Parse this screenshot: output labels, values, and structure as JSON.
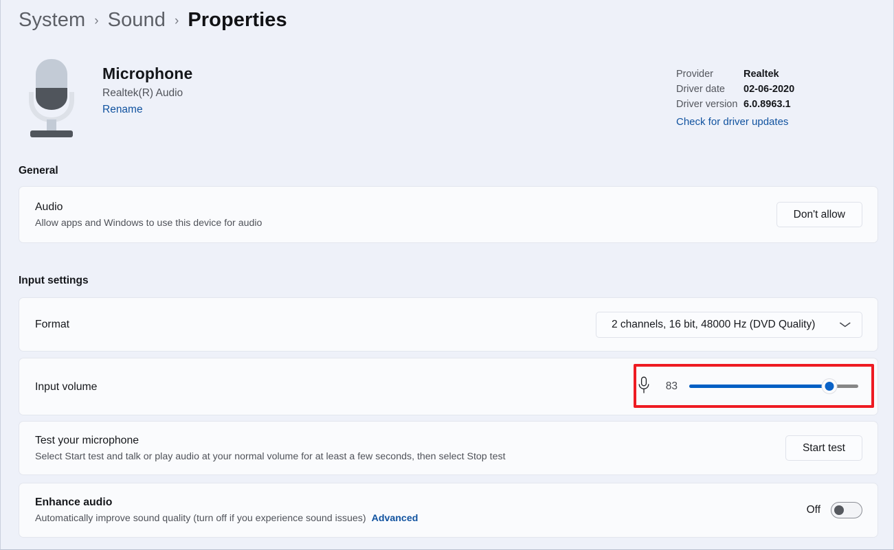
{
  "breadcrumb": {
    "items": [
      {
        "label": "System",
        "current": false
      },
      {
        "label": "Sound",
        "current": false
      },
      {
        "label": "Properties",
        "current": true
      }
    ],
    "separator": "›"
  },
  "device": {
    "icon": "microphone-icon",
    "name": "Microphone",
    "subtitle": "Realtek(R) Audio",
    "rename_link": "Rename"
  },
  "driver": {
    "provider_label": "Provider",
    "provider_value": "Realtek",
    "date_label": "Driver date",
    "date_value": "02-06-2020",
    "version_label": "Driver version",
    "version_value": "6.0.8963.1",
    "update_link": "Check for driver updates"
  },
  "general": {
    "section_title": "General",
    "audio": {
      "title": "Audio",
      "description": "Allow apps and Windows to use this device for audio",
      "button_label": "Don't allow"
    }
  },
  "input_settings": {
    "section_title": "Input settings",
    "format": {
      "title": "Format",
      "selected_option": "2 channels, 16 bit, 48000 Hz (DVD Quality)",
      "chevron": "⌄"
    },
    "input_volume": {
      "title": "Input volume",
      "icon": "microphone-small-icon",
      "value": "83",
      "min": "0",
      "max": "100",
      "highlighted": true
    },
    "test_microphone": {
      "title": "Test your microphone",
      "description": "Select Start test and talk or play audio at your normal volume for at least a few seconds, then select Stop test",
      "button_label": "Start test"
    },
    "enhance_audio": {
      "title": "Enhance audio",
      "description": "Automatically improve sound quality (turn off if you experience sound issues)",
      "advanced_link": "Advanced",
      "toggle_state_label": "Off"
    }
  },
  "colors": {
    "accent": "#005fc4",
    "link": "#10529f",
    "page_background": "#eef1f9",
    "card_background": "#fafbfd",
    "annotation": "#ee1b22"
  }
}
